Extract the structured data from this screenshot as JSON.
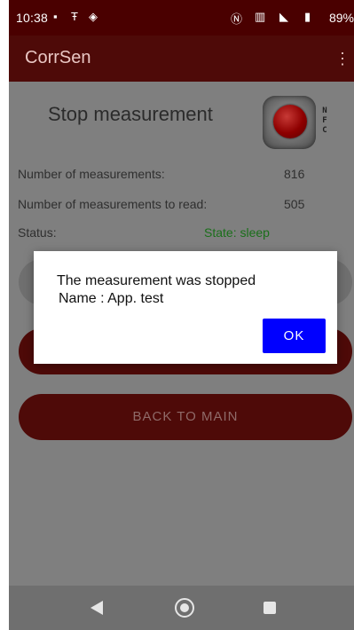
{
  "status_bar": {
    "time": "10:38",
    "battery": "89%"
  },
  "app_bar": {
    "title": "CorrSen"
  },
  "measurement": {
    "title": "Stop measurement",
    "nfc_letters": [
      "N",
      "F",
      "C"
    ],
    "rows": [
      {
        "label": "Number of measurements:",
        "value": "816"
      },
      {
        "label": "Number of measurements to read:",
        "value": "505"
      },
      {
        "label": "Status:",
        "value": "State:  sleep"
      }
    ]
  },
  "buttons": {
    "back_to_main": "BACK TO MAIN"
  },
  "dialog": {
    "message_line1": "The measurement was stopped",
    "message_line2": " Name : App. test",
    "ok": "OK"
  },
  "icons": {
    "status": [
      "image-icon",
      "t-mobile-icon",
      "shield-icon",
      "nfc-icon",
      "vibrate-icon",
      "wifi-icon",
      "battery-icon"
    ],
    "nav": [
      "back-icon",
      "home-icon",
      "recents-icon"
    ]
  },
  "colors": {
    "app_bar": "#4e0a08",
    "accent_button": "#0000ff",
    "status_green": "#1a6f1a"
  }
}
